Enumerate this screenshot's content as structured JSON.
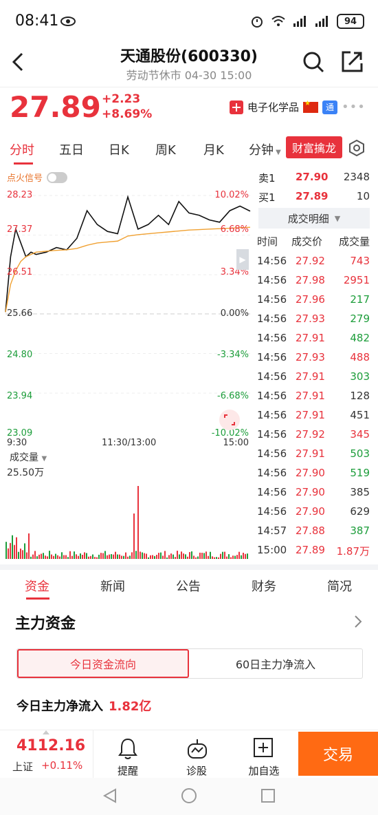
{
  "status": {
    "time": "08:41",
    "battery": "94"
  },
  "header": {
    "title": "天通股份(600330)",
    "subtitle": "劳动节休市 04-30 15:00"
  },
  "quote": {
    "price": "27.89",
    "change": "+2.23",
    "change_pct": "+8.69%",
    "industry": "电子化学品",
    "tong": "通"
  },
  "tabs": {
    "items": [
      "分时",
      "五日",
      "日K",
      "周K",
      "月K",
      "分钟"
    ],
    "special": "财富擒龙"
  },
  "chart": {
    "signal_label": "点火信号",
    "y_left": [
      "28.23",
      "27.37",
      "26.51",
      "25.66",
      "24.80",
      "23.94",
      "23.09"
    ],
    "y_right": [
      "10.02%",
      "6.68%",
      "3.34%",
      "0.00%",
      "-3.34%",
      "-6.68%",
      "-10.02%"
    ],
    "x_labels": [
      "9:30",
      "11:30/13:00",
      "15:00"
    ],
    "volume_label": "成交量",
    "volume_max": "25.50万"
  },
  "chart_data": {
    "type": "line",
    "ylim": [
      23.09,
      28.23
    ],
    "prev_close": 25.66,
    "x": [
      0,
      5,
      10,
      15,
      20,
      25,
      30,
      40,
      50,
      60,
      70,
      80,
      90,
      100,
      110,
      120,
      130,
      140,
      150,
      160,
      170,
      180,
      190,
      200,
      210,
      220,
      230,
      240
    ],
    "series": [
      {
        "values": [
          25.7,
          26.9,
          27.5,
          27.2,
          26.9,
          27.0,
          26.95,
          27.0,
          27.1,
          27.05,
          27.3,
          27.9,
          27.6,
          27.45,
          27.4,
          28.2,
          27.5,
          27.6,
          27.8,
          27.6,
          28.1,
          27.85,
          27.8,
          27.7,
          27.65,
          27.9,
          28.0,
          27.89
        ]
      },
      {
        "values": [
          25.7,
          26.3,
          26.6,
          26.8,
          26.9,
          26.95,
          27.0,
          27.02,
          27.04,
          27.05,
          27.08,
          27.15,
          27.2,
          27.22,
          27.24,
          27.35,
          27.38,
          27.4,
          27.42,
          27.44,
          27.46,
          27.48,
          27.49,
          27.5,
          27.51,
          27.52,
          27.53,
          27.54
        ]
      }
    ]
  },
  "order_book": [
    {
      "label": "卖1",
      "price": "27.90",
      "vol": "2348"
    },
    {
      "label": "买1",
      "price": "27.89",
      "vol": "10"
    }
  ],
  "detail_btn": "成交明细",
  "ticks_header": {
    "time": "时间",
    "price": "成交价",
    "vol": "成交量"
  },
  "ticks": [
    {
      "t": "14:56",
      "p": "27.92",
      "v": "743",
      "c": "#e8323c"
    },
    {
      "t": "14:56",
      "p": "27.98",
      "v": "2951",
      "c": "#e8323c"
    },
    {
      "t": "14:56",
      "p": "27.96",
      "v": "217",
      "c": "#1c9d3a"
    },
    {
      "t": "14:56",
      "p": "27.93",
      "v": "279",
      "c": "#1c9d3a"
    },
    {
      "t": "14:56",
      "p": "27.91",
      "v": "482",
      "c": "#1c9d3a"
    },
    {
      "t": "14:56",
      "p": "27.93",
      "v": "488",
      "c": "#e8323c"
    },
    {
      "t": "14:56",
      "p": "27.91",
      "v": "303",
      "c": "#1c9d3a"
    },
    {
      "t": "14:56",
      "p": "27.91",
      "v": "128",
      "c": "#333333"
    },
    {
      "t": "14:56",
      "p": "27.91",
      "v": "451",
      "c": "#333333"
    },
    {
      "t": "14:56",
      "p": "27.92",
      "v": "345",
      "c": "#e8323c"
    },
    {
      "t": "14:56",
      "p": "27.91",
      "v": "503",
      "c": "#1c9d3a"
    },
    {
      "t": "14:56",
      "p": "27.90",
      "v": "519",
      "c": "#1c9d3a"
    },
    {
      "t": "14:56",
      "p": "27.90",
      "v": "385",
      "c": "#333333"
    },
    {
      "t": "14:56",
      "p": "27.90",
      "v": "629",
      "c": "#333333"
    },
    {
      "t": "14:57",
      "p": "27.88",
      "v": "387",
      "c": "#1c9d3a"
    },
    {
      "t": "15:00",
      "p": "27.89",
      "v": "1.87万",
      "c": "#e8323c"
    }
  ],
  "section_tabs": [
    "资金",
    "新闻",
    "公告",
    "财务",
    "简况"
  ],
  "funds": {
    "title": "主力资金",
    "seg_a": "今日资金流向",
    "seg_b": "60日主力净流入",
    "net_label": "今日主力净流入",
    "net_value": "1.82亿"
  },
  "bottom": {
    "index_value": "4112.16",
    "index_name": "上证",
    "index_chg": "+0.11%",
    "remind": "提醒",
    "diagnose": "诊股",
    "add": "加自选",
    "trade": "交易"
  }
}
